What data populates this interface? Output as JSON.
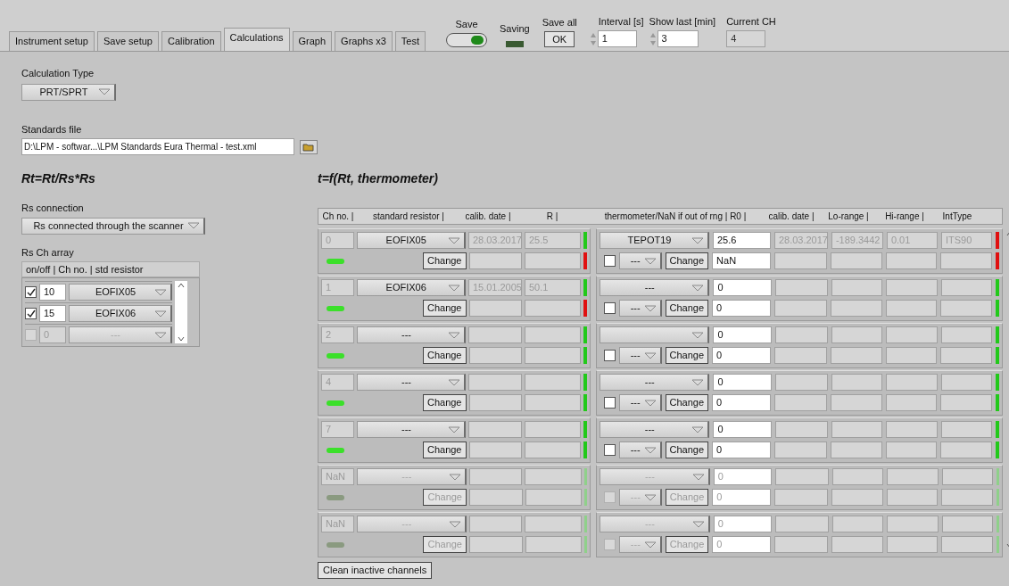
{
  "tabs": [
    {
      "label": "Instrument setup",
      "selected": false
    },
    {
      "label": "Save setup",
      "selected": false
    },
    {
      "label": "Calibration",
      "selected": false
    },
    {
      "label": "Calculations",
      "selected": true
    },
    {
      "label": "Graph",
      "selected": false
    },
    {
      "label": "Graphs x3",
      "selected": false
    },
    {
      "label": "Test",
      "selected": false
    }
  ],
  "top_controls": {
    "save": {
      "label": "Save",
      "on": true
    },
    "saving": {
      "label": "Saving",
      "on": false
    },
    "save_all": {
      "label": "Save all",
      "button": "OK"
    },
    "interval": {
      "label": "Interval [s]",
      "value": "1"
    },
    "show_last": {
      "label": "Show last [min]",
      "value": "3"
    },
    "current_ch": {
      "label": "Current CH",
      "value": "4"
    }
  },
  "calculation_type": {
    "label": "Calculation Type",
    "value": "PRT/SPRT"
  },
  "standards_file": {
    "label": "Standards file",
    "value": "D:\\LPM - softwar...\\LPM Standards Eura Thermal - test.xml"
  },
  "left_formula": "Rt=Rt/Rs*Rs",
  "rs_connection": {
    "label": "Rs connection",
    "value": "Rs connected through the scanner"
  },
  "rs_ch_array": {
    "label": "Rs Ch array",
    "header": "on/off | Ch no. | std resistor",
    "rows": [
      {
        "checked": true,
        "disabled": false,
        "ch": "10",
        "resistor": "EOFIX05"
      },
      {
        "checked": true,
        "disabled": false,
        "ch": "15",
        "resistor": "EOFIX06"
      },
      {
        "checked": false,
        "disabled": true,
        "ch": "0",
        "resistor": "---"
      }
    ]
  },
  "right_formula": "t=f(Rt, thermometer)",
  "table": {
    "left_columns": [
      "Ch no. |",
      "standard resistor |",
      "calib. date |",
      "R |"
    ],
    "right_columns": [
      "thermometer/NaN if out of rng | R0 |",
      "calib. date |",
      "Lo-range |",
      "Hi-range |",
      "IntType"
    ],
    "rows": [
      {
        "active": true,
        "ch": "0",
        "resistor": "EOFIX05",
        "calib_date": "28.03.2017",
        "r": "25.5",
        "resistor_change": "Change",
        "left_lights": [
          {
            "color": "#22c91a"
          },
          {
            "color": "#e01010"
          }
        ],
        "thermometer": "TEPOT19",
        "checked": false,
        "sub": "---",
        "thermometer_change": "Change",
        "r0": "25.6",
        "r0_alt": "NaN",
        "t_calib_date": "28.03.2017",
        "lo_range": "-189.3442",
        "hi_range": "0.01",
        "int_type": "ITS90",
        "right_lights": [
          {
            "color": "#e01010"
          },
          {
            "color": "#e01010"
          }
        ]
      },
      {
        "active": true,
        "ch": "1",
        "resistor": "EOFIX06",
        "calib_date": "15.01.2005",
        "r": "50.1",
        "resistor_change": "Change",
        "left_lights": [
          {
            "color": "#22c91a"
          },
          {
            "color": "#e01010"
          }
        ],
        "thermometer": "---",
        "checked": false,
        "sub": "---",
        "thermometer_change": "Change",
        "r0": "0",
        "r0_alt": "0",
        "right_lights": [
          {
            "color": "#22c91a"
          },
          {
            "color": "#22c91a"
          }
        ]
      },
      {
        "active": true,
        "ch": "2",
        "resistor": "---",
        "resistor_change": "Change",
        "left_lights": [
          {
            "color": "#22c91a"
          },
          {
            "color": "#22c91a"
          }
        ],
        "checked": false,
        "sub": "---",
        "thermometer_change": "Change",
        "r0": "0",
        "r0_alt": "0",
        "right_lights": [
          {
            "color": "#22c91a"
          },
          {
            "color": "#22c91a"
          }
        ]
      },
      {
        "active": true,
        "ch": "4",
        "resistor": "---",
        "resistor_change": "Change",
        "left_lights": [
          {
            "color": "#22c91a"
          },
          {
            "color": "#22c91a"
          }
        ],
        "thermometer": "---",
        "checked": false,
        "sub": "---",
        "thermometer_change": "Change",
        "r0": "0",
        "r0_alt": "0",
        "right_lights": [
          {
            "color": "#22c91a"
          },
          {
            "color": "#22c91a"
          }
        ]
      },
      {
        "active": true,
        "ch": "7",
        "resistor": "---",
        "resistor_change": "Change",
        "left_lights": [
          {
            "color": "#22c91a"
          },
          {
            "color": "#22c91a"
          }
        ],
        "thermometer": "---",
        "checked": false,
        "sub": "---",
        "thermometer_change": "Change",
        "r0": "0",
        "r0_alt": "0",
        "right_lights": [
          {
            "color": "#22c91a"
          },
          {
            "color": "#22c91a"
          }
        ]
      },
      {
        "active": false,
        "ch": "NaN",
        "resistor": "---",
        "resistor_change": "Change",
        "left_lights": [
          {
            "color": "#8fd08a"
          },
          {
            "color": "#8fd08a"
          }
        ],
        "thermometer": "---",
        "checked": false,
        "sub": "---",
        "thermometer_change": "Change",
        "r0": "0",
        "r0_alt": "0",
        "right_lights": [
          {
            "color": "#8fd08a"
          },
          {
            "color": "#8fd08a"
          }
        ]
      },
      {
        "active": false,
        "ch": "NaN",
        "resistor": "---",
        "resistor_change": "Change",
        "left_lights": [
          {
            "color": "#8fd08a"
          },
          {
            "color": "#8fd08a"
          }
        ],
        "thermometer": "---",
        "checked": false,
        "sub": "---",
        "thermometer_change": "Change",
        "r0": "0",
        "r0_alt": "0",
        "right_lights": [
          {
            "color": "#8fd08a"
          },
          {
            "color": "#8fd08a"
          }
        ]
      }
    ]
  },
  "clean_button": "Clean inactive channels"
}
